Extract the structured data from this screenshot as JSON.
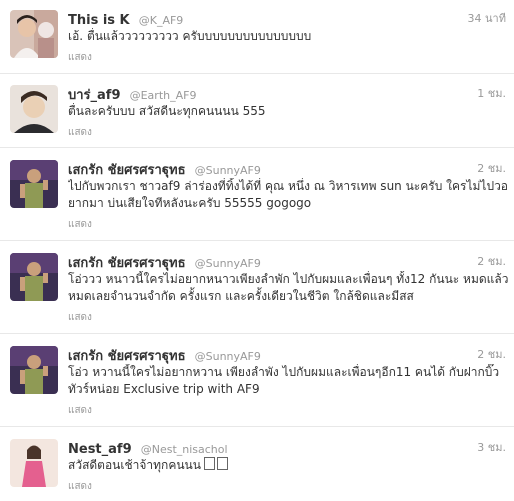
{
  "tweets": [
    {
      "name": "This is K",
      "handle": "@K_AF9",
      "time": "34 นาที",
      "text": "เอ้. ตื่นแล้ววววววววว ครับบบบบบบบบบบบบบบ",
      "expand": "แสดง"
    },
    {
      "name": "บาร่_af9",
      "handle": "@Earth_AF9",
      "time": "1 ชม.",
      "text": "ตื่นละครับบบ สวัสดีนะทุกคนนนน 555",
      "expand": "แสดง"
    },
    {
      "name": "เสกรัก ชัยศรศราฐุทธ",
      "handle": "@SunnyAF9",
      "time": "2 ชม.",
      "text": "ไปกับพวกเรา ชาวaf9 ล่าร่องที่ทิ้งได้ที่ คุณ หนึ่ง ณ วิหารเทพ sun นะครับ ใครไม่ไปวอยากมา บ่นเสียใจทีหลังนะครับ 55555 gogogo",
      "expand": "แสดง"
    },
    {
      "name": "เสกรัก ชัยศรศราฐุทธ",
      "handle": "@SunnyAF9",
      "time": "2 ชม.",
      "text": "โอ่ววว หนาวนี้ใครไม่อยากหนาวเพียงลำพัก ไปกับผมและเพื่อนๆ ทั้ง12 กันนะ หมดแล้วหมดเลยจำนวนจำกัด ครั้งแรก และครั้งเดียวในชีวิต ใกล้ชิดและมีสส",
      "expand": "แสดง"
    },
    {
      "name": "เสกรัก ชัยศรศราฐุทธ",
      "handle": "@SunnyAF9",
      "time": "2 ชม.",
      "text": "โอ่ว หวานนี้ใครไม่อยากหวาน เพียงลำพัง ไปกับผมและเพื่อนๆอีก11 คนได้ กับฝากบิ๊วทัวร์หน่อย Exclusive trip with AF9",
      "expand": "แสดง"
    },
    {
      "name": "Nest_af9",
      "handle": "@Nest_nisachol",
      "time": "3 ชม.",
      "text": "สวัสดีตอนเช้าจ้าทุกคนนน",
      "expand": "แสดง"
    }
  ]
}
